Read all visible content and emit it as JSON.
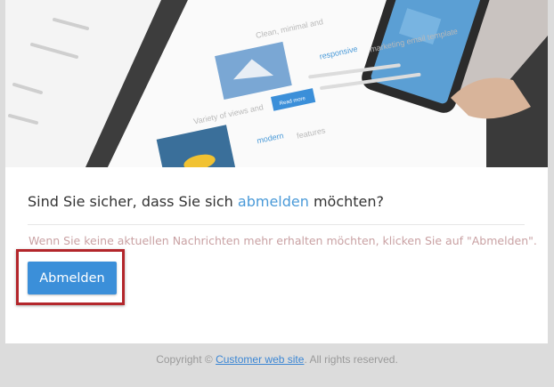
{
  "hero": {
    "preview_words": [
      "Clean, minimal and",
      "responsive",
      "marketing email template",
      "Read more",
      "Variety of views and",
      "modern",
      "features"
    ],
    "accent_color": "#4a9ad8"
  },
  "question": {
    "before": "Sind Sie sicher, dass Sie sich ",
    "accent": "abmelden",
    "after": " möchten?"
  },
  "info_text": "Wenn Sie keine aktuellen Nachrichten mehr erhalten möchten, klicken Sie auf \"Abmelden\".",
  "unsubscribe_button": {
    "label": "Abmelden",
    "color": "#3b8fd9"
  },
  "highlight_color": "#b3262b",
  "footer": {
    "prefix": "Copyright © ",
    "link": "Customer web site",
    "suffix": ". All rights reserved."
  }
}
